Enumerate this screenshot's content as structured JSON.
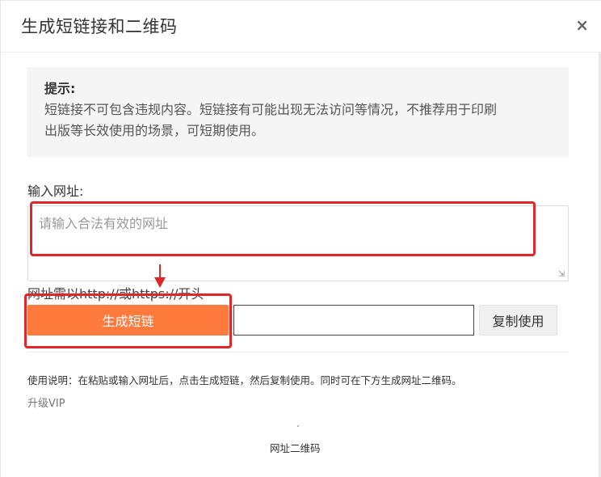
{
  "dialog": {
    "title": "生成短链接和二维码",
    "close_icon": "×"
  },
  "tip": {
    "title": "提示:",
    "line1": "短链接不可包含违规内容。短链接有可能出现无法访问等情况，不推荐用于印刷",
    "line2": "出版等长效使用的场景，可短期使用。"
  },
  "form": {
    "url_label": "输入网址:",
    "url_placeholder": "请输入合法有效的网址",
    "url_value": "",
    "hint": "网址需以http://或https://开头",
    "generate_label": "生成短链",
    "short_link_value": "",
    "copy_label": "复制使用"
  },
  "footer": {
    "usage": "使用说明：在粘贴或输入网址后，点击生成短链，然后复制使用。同时可在下方生成网址二维码。",
    "upgrade": "升级VIP",
    "qr_label": "网址二维码"
  },
  "colors": {
    "accent": "#ff7a3d",
    "highlight": "#e0262a",
    "tip_bg": "#f5f5f5"
  }
}
